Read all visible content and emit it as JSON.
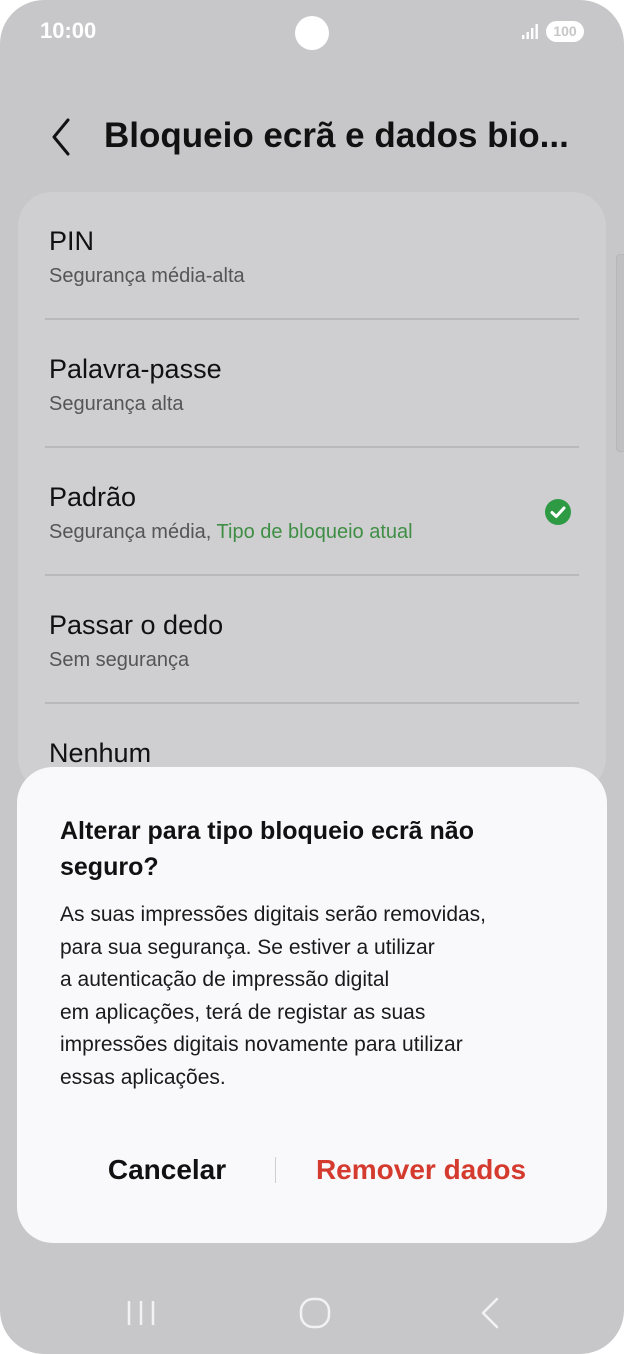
{
  "status_bar": {
    "time": "10:00",
    "battery": "100"
  },
  "header": {
    "title": "Bloqueio ecrã e dados bio..."
  },
  "options": [
    {
      "title": "PIN",
      "subtitle": "Segurança média-alta"
    },
    {
      "title": "Palavra-passe",
      "subtitle": "Segurança alta"
    },
    {
      "title": "Padrão",
      "subtitle": "Segurança média,",
      "current_label": "Tipo de bloqueio atual"
    },
    {
      "title": "Passar o dedo",
      "subtitle": "Sem segurança"
    },
    {
      "title": "Nenhum"
    }
  ],
  "dialog": {
    "title_lines": [
      "Alterar para tipo bloqueio ecrã não",
      "seguro?"
    ],
    "body_lines": [
      "As suas impressões digitais serão removidas,",
      "para sua segurança. Se estiver a utilizar",
      "a autenticação de impressão digital",
      "em aplicações, terá de registar as suas",
      "impressões digitais novamente para utilizar",
      "essas aplicações."
    ],
    "cancel_label": "Cancelar",
    "remove_label": "Remover dados"
  },
  "colors": {
    "accent_green": "#3f8e45",
    "destructive_red": "#d43a2d",
    "scrim_background": "#c7c7c9"
  },
  "icons": {
    "back": "chevron-left-icon",
    "current_check": "check-circle-icon",
    "nav_recent": "recent-apps-icon",
    "nav_home": "home-icon",
    "nav_back": "back-icon"
  }
}
